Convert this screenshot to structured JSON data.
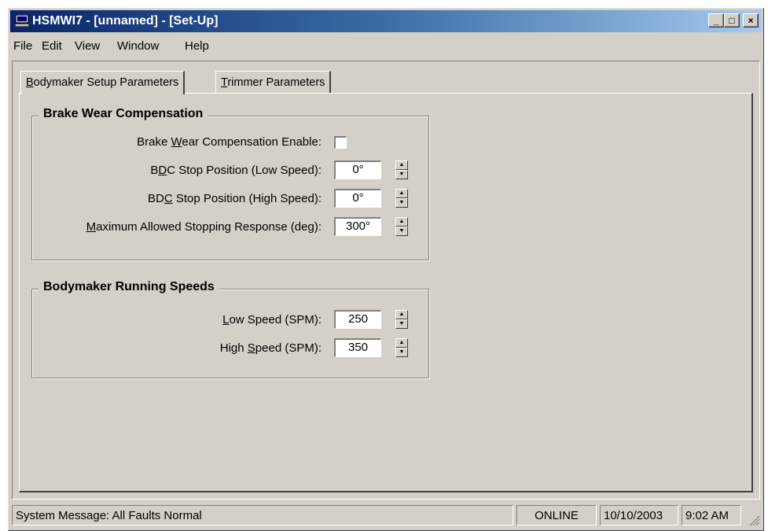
{
  "window": {
    "title": "HSMWI7 - [unnamed] - [Set-Up]",
    "icon": "computer-icon",
    "controls": {
      "minimize": "_",
      "maximize": "□",
      "close": "×"
    }
  },
  "menu": {
    "items": [
      "File",
      "Edit",
      "View",
      "Window",
      "Help"
    ]
  },
  "tabs": {
    "active": {
      "pre": "",
      "mnemonic": "B",
      "post": "odymaker Setup Parameters"
    },
    "inactive": {
      "pre": "",
      "mnemonic": "T",
      "post": "rimmer Parameters"
    }
  },
  "brake_group": {
    "title": "Brake Wear Compensation",
    "enable": {
      "pre": "Brake ",
      "mnemonic": "W",
      "post": "ear Compensation Enable:",
      "checked": false
    },
    "low": {
      "pre": "B",
      "mnemonic": "D",
      "post": "C Stop Position (Low Speed):",
      "value": "0°"
    },
    "high": {
      "pre": "BD",
      "mnemonic": "C",
      "post": " Stop Position (High Speed):",
      "value": "0°"
    },
    "max": {
      "pre": "",
      "mnemonic": "M",
      "post": "aximum Allowed Stopping Response (deg):",
      "value": "300°"
    }
  },
  "speed_group": {
    "title": "Bodymaker Running Speeds",
    "low": {
      "pre": "",
      "mnemonic": "L",
      "post": "ow Speed (SPM):",
      "value": "250"
    },
    "high": {
      "pre": "High ",
      "mnemonic": "S",
      "post": "peed (SPM):",
      "value": "350"
    }
  },
  "status": {
    "message": "System Message:  All Faults Normal",
    "connection": "ONLINE",
    "date": "10/10/2003",
    "time": "9:02 AM"
  }
}
